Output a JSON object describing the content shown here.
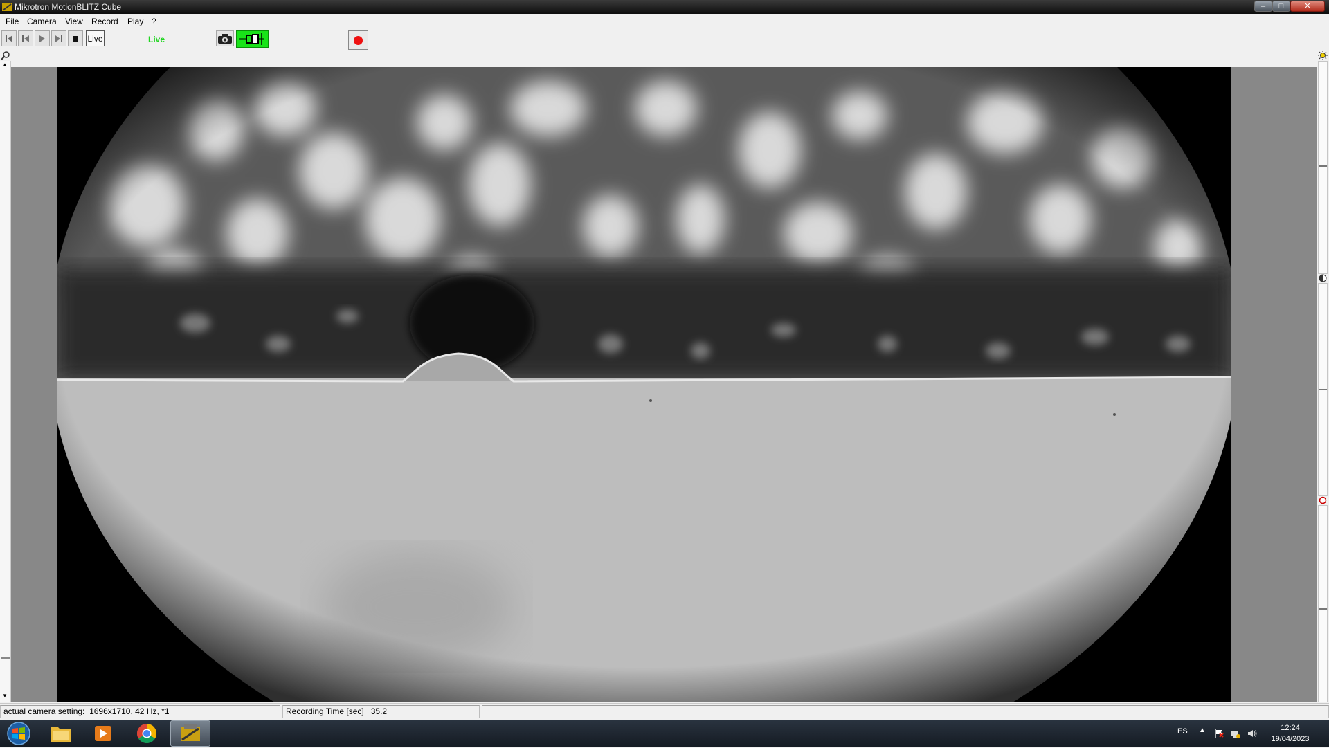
{
  "window": {
    "title": "Mikrotron MotionBLITZ Cube"
  },
  "menu": {
    "items": [
      "File",
      "Camera",
      "View",
      "Record",
      "Play",
      "?"
    ]
  },
  "toolbar": {
    "live_label": "Live",
    "live_status": "Live",
    "connect_color": "#19e319",
    "record_color": "#ee1010"
  },
  "status": {
    "camera_setting_label": "actual camera setting:",
    "camera_setting_value": "1696x1710, 42 Hz, *1",
    "recording_time_label": "Recording Time [sec]",
    "recording_time_value": "35.2"
  },
  "taskbar": {
    "apps": [
      "start-orb-icon",
      "file-explorer-icon",
      "media-player-icon",
      "chrome-icon",
      "motionblitz-icon"
    ],
    "language": "ES",
    "time": "12:24",
    "date": "19/04/2023"
  }
}
